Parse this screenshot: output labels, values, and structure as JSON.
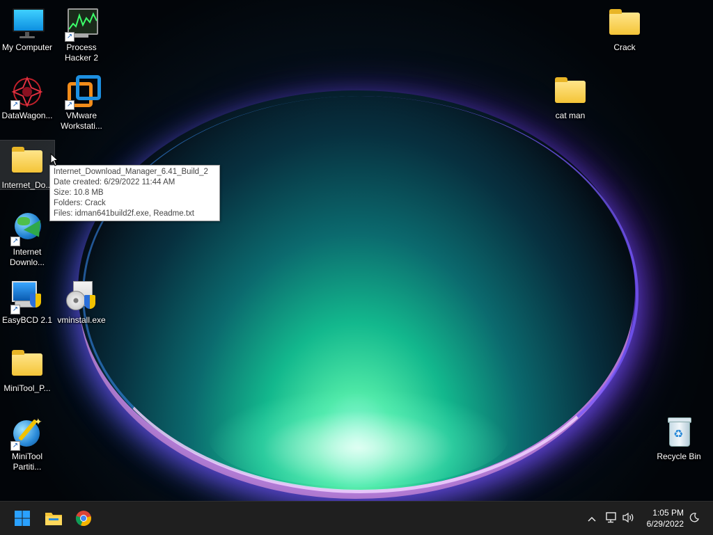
{
  "desktop": {
    "icons": [
      {
        "id": "my-computer",
        "label": "My Computer"
      },
      {
        "id": "process-hacker",
        "label": "Process\nHacker 2"
      },
      {
        "id": "datawagon",
        "label": "DataWagon..."
      },
      {
        "id": "vmware",
        "label": "VMware\nWorkstati..."
      },
      {
        "id": "internet-download-folder",
        "label": "Internet_Do..."
      },
      {
        "id": "internet-download-manager",
        "label": "Internet\nDownlo..."
      },
      {
        "id": "easybcd",
        "label": "EasyBCD 2.1"
      },
      {
        "id": "vminstall",
        "label": "vminstall.exe"
      },
      {
        "id": "minitool-folder",
        "label": "MiniTool_P..."
      },
      {
        "id": "minitool-partition",
        "label": "MiniTool\nPartiti..."
      },
      {
        "id": "crack",
        "label": "Crack"
      },
      {
        "id": "cat-man",
        "label": "cat man"
      },
      {
        "id": "recycle-bin",
        "label": "Recycle Bin"
      }
    ]
  },
  "tooltip": {
    "name": "Internet_Download_Manager_6.41_Build_2",
    "date_created": "Date created: 6/29/2022 11:44 AM",
    "size": "Size: 10.8 MB",
    "folders": "Folders: Crack",
    "files": "Files: idman641build2f.exe, Readme.txt"
  },
  "taskbar": {
    "clock_time": "1:05 PM",
    "clock_date": "6/29/2022",
    "accent": "#0a84ff"
  }
}
